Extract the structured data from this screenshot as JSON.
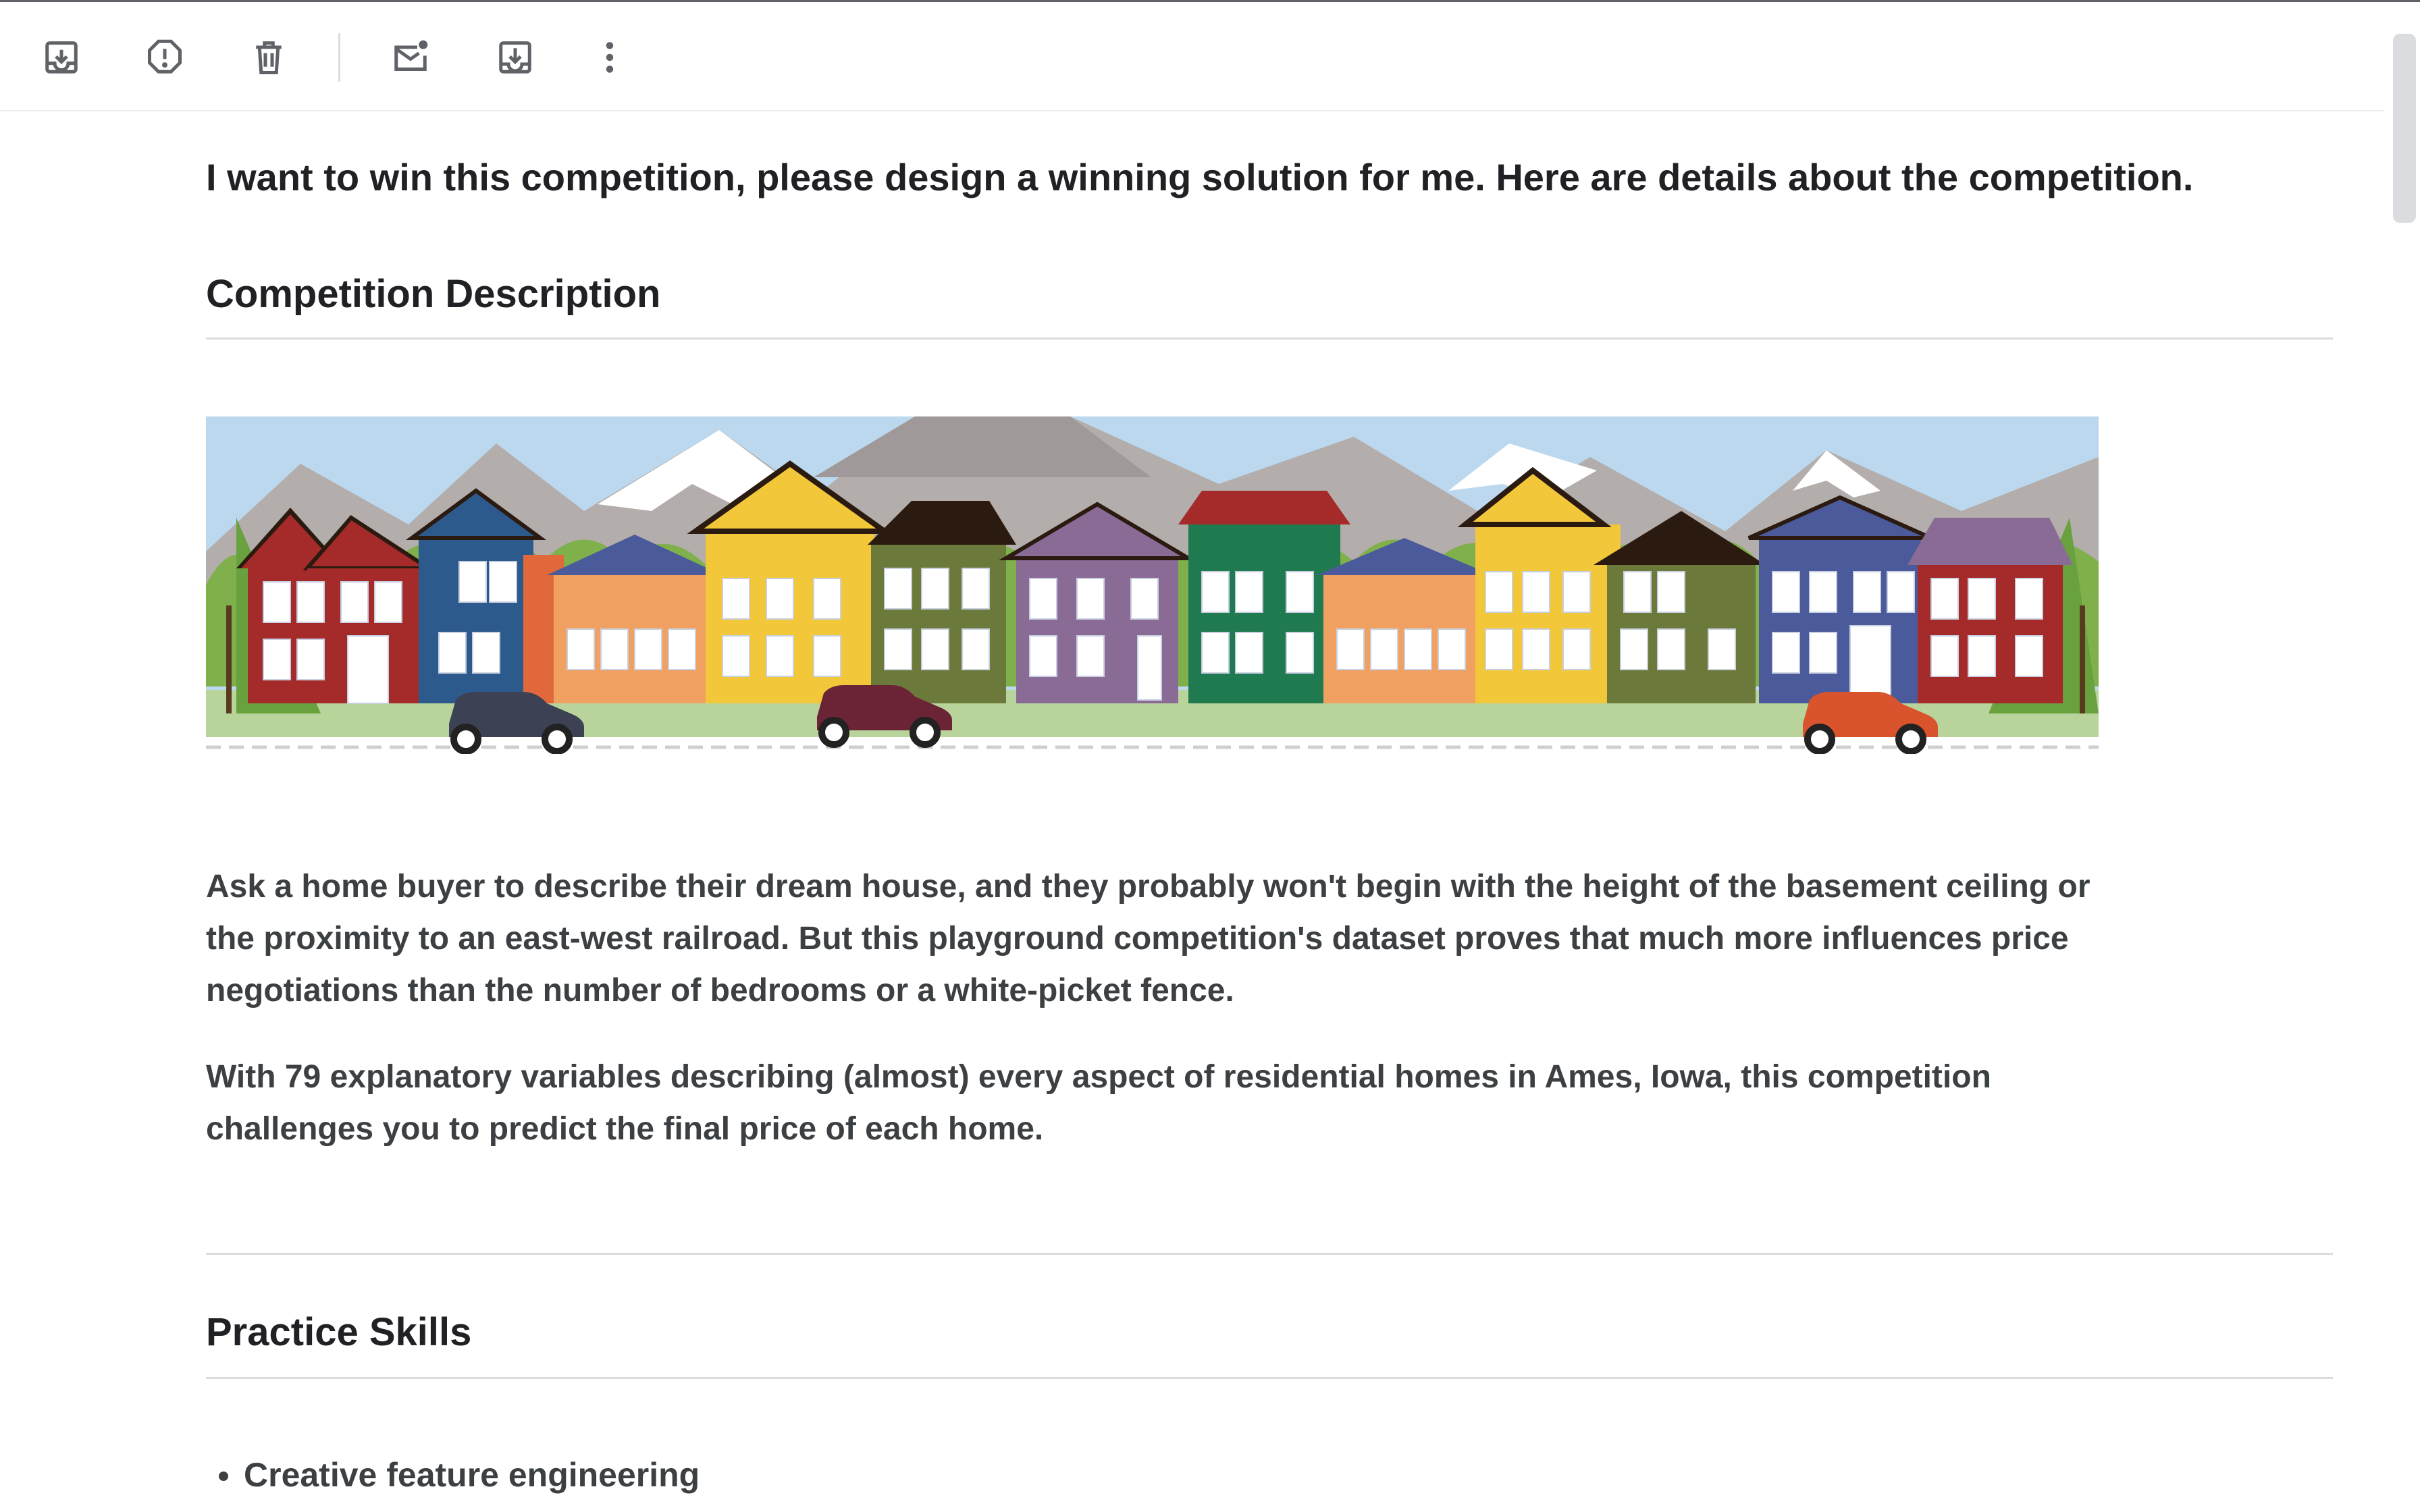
{
  "toolbar": {
    "actions": [
      {
        "name": "archive",
        "icon": "archive-icon"
      },
      {
        "name": "report-spam",
        "icon": "report-spam-icon"
      },
      {
        "name": "delete",
        "icon": "trash-icon"
      },
      {
        "name": "mark-unread",
        "icon": "mark-unread-icon"
      },
      {
        "name": "move-to",
        "icon": "move-to-icon"
      },
      {
        "name": "more",
        "icon": "more-vert-icon"
      }
    ]
  },
  "email": {
    "subject": "I want to win this competition, please design a winning solution for me. Here are details about the competition.",
    "section1_heading": "Competition Description",
    "banner_icon": "houses-illustration",
    "paragraph1": "Ask a home buyer to describe their dream house, and they probably won't begin with the height of the basement ceiling or the proximity to an east-west railroad. But this playground competition's dataset proves that much more influences price negotiations than the number of bedrooms or a white-picket fence.",
    "paragraph2": "With 79 explanatory variables describing (almost) every aspect of residential homes in Ames, Iowa, this competition challenges you to predict the final price of each home.",
    "section2_heading": "Practice Skills",
    "skills": [
      "Creative feature engineering"
    ]
  },
  "colors": {
    "icon": "#5f6368",
    "heading": "#202124",
    "body": "#3c4043",
    "divider": "#dadce0"
  }
}
